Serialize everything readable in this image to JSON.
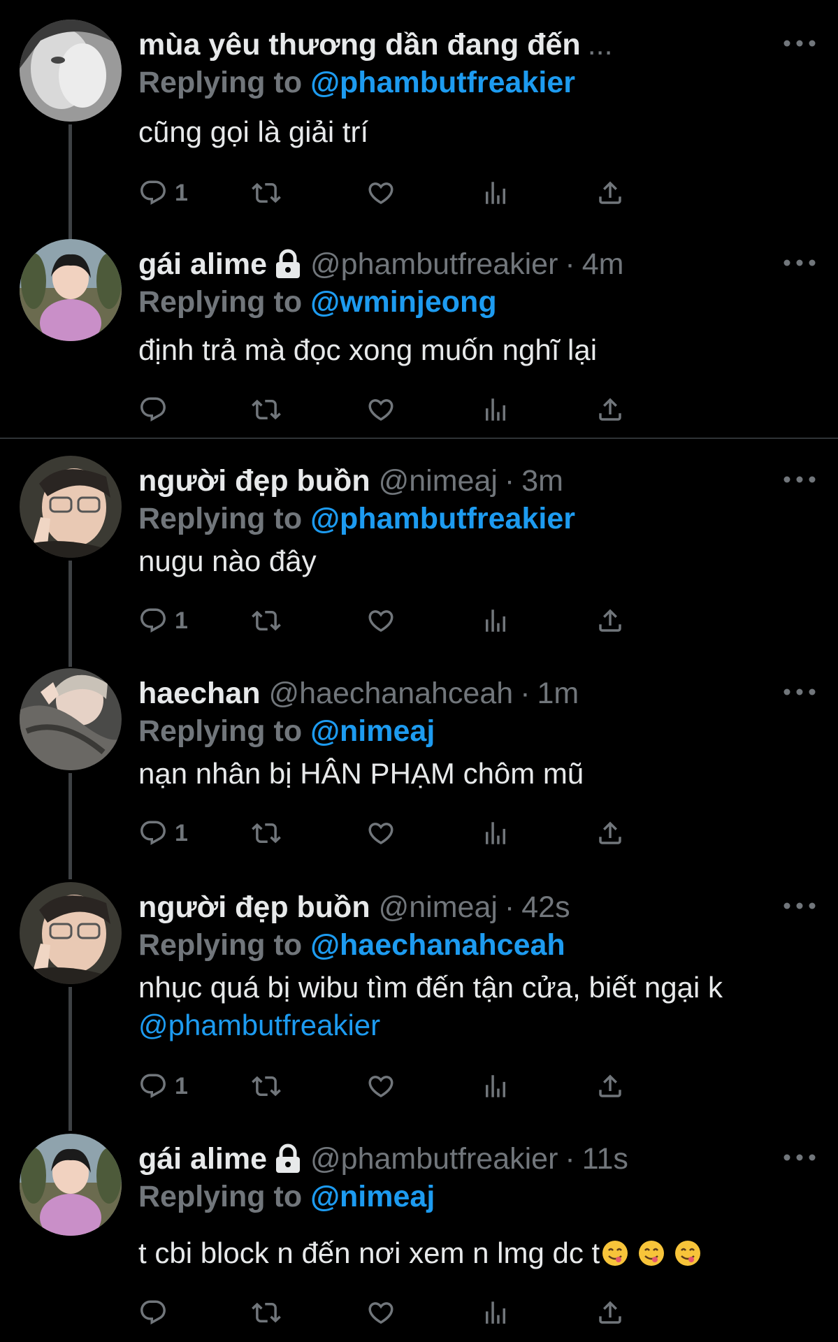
{
  "tweets": [
    {
      "display_name": "mùa yêu thương dần đang đến",
      "truncated": "...",
      "locked": false,
      "handle": "",
      "time": "",
      "replying_label": "Replying to",
      "replying_to": "@phambutfreakier",
      "text": "cũng gọi là giải trí",
      "reply_count": "1",
      "avatar_icon": "avatar-photo-icon"
    },
    {
      "display_name": "gái alime",
      "locked": true,
      "handle": "@phambutfreakier",
      "separator": "·",
      "time": "4m",
      "replying_label": "Replying to",
      "replying_to": "@wminjeong",
      "text": "định trả mà đọc xong muốn nghĩ lại",
      "reply_count": "",
      "avatar_icon": "avatar-photo-icon"
    },
    {
      "display_name": "người đẹp buồn",
      "locked": false,
      "handle": "@nimeaj",
      "separator": "·",
      "time": "3m",
      "replying_label": "Replying to",
      "replying_to": "@phambutfreakier",
      "text": "nugu nào đây",
      "reply_count": "1",
      "avatar_icon": "avatar-photo-icon"
    },
    {
      "display_name": "haechan",
      "locked": false,
      "handle": "@haechanahceah",
      "separator": "·",
      "time": "1m",
      "replying_label": "Replying to",
      "replying_to": "@nimeaj",
      "text": "nạn nhân bị HÂN PHẠM chôm mũ",
      "reply_count": "1",
      "avatar_icon": "avatar-photo-icon"
    },
    {
      "display_name": "người đẹp buồn",
      "locked": false,
      "handle": "@nimeaj",
      "separator": "·",
      "time": "42s",
      "replying_label": "Replying to",
      "replying_to": "@haechanahceah",
      "text": "nhục quá bị wibu tìm đến tận cửa, biết ngại k",
      "text_mention": "@phambutfreakier",
      "reply_count": "1",
      "avatar_icon": "avatar-photo-icon"
    },
    {
      "display_name": "gái alime",
      "locked": true,
      "handle": "@phambutfreakier",
      "separator": "·",
      "time": "11s",
      "replying_label": "Replying to",
      "replying_to": "@nimeaj",
      "text": "t cbi block n đến nơi xem n lmg dc t",
      "emoji": "😋",
      "reply_count": "",
      "avatar_icon": "avatar-photo-icon"
    }
  ],
  "action_icons": [
    "reply-icon",
    "retweet-icon",
    "like-icon",
    "views-icon",
    "share-icon"
  ],
  "colors": {
    "background": "#000000",
    "text": "#e7e9ea",
    "muted": "#71767b",
    "accent": "#1d9bf0",
    "divider": "#2f3336",
    "thread_line": "#3e4144"
  }
}
